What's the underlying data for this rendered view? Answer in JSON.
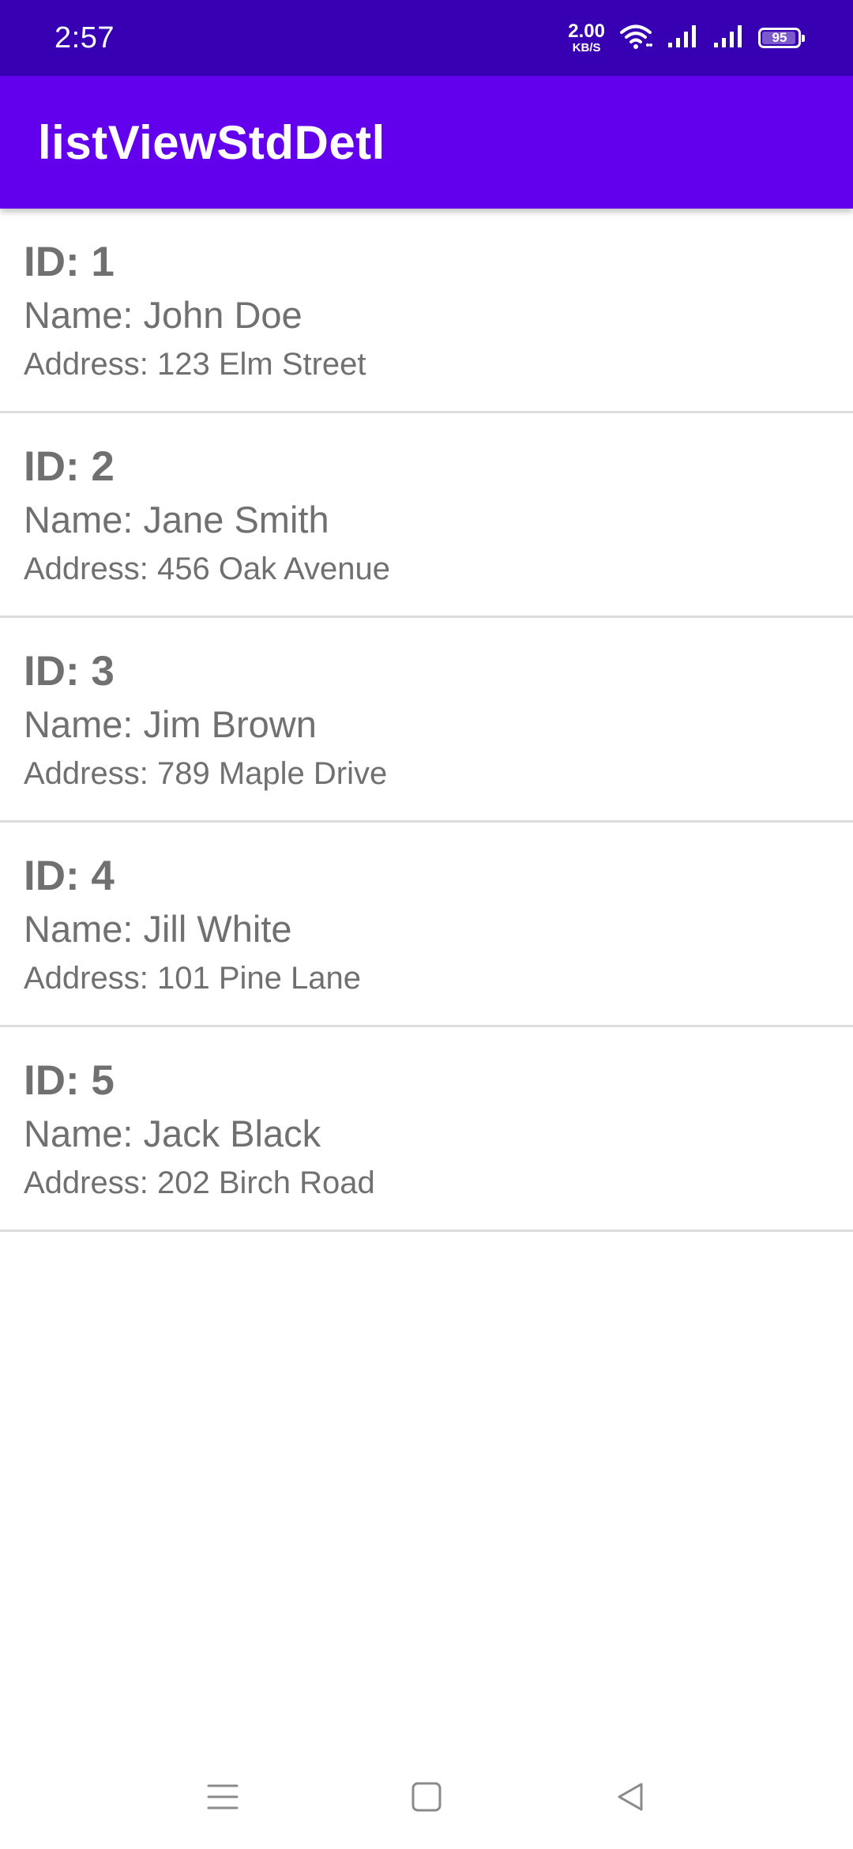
{
  "status_bar": {
    "time": "2:57",
    "net_speed_value": "2.00",
    "net_speed_unit": "KB/S",
    "battery_level": "95",
    "icons": [
      "wifi-icon",
      "signal-icon",
      "signal-icon",
      "battery-icon"
    ]
  },
  "app_bar": {
    "title": "listViewStdDetl",
    "color": "#6200ee",
    "status_color": "#3700b3"
  },
  "students": [
    {
      "id": "ID: 1",
      "name": "Name: John Doe",
      "address": "Address: 123 Elm Street"
    },
    {
      "id": "ID: 2",
      "name": "Name: Jane Smith",
      "address": "Address: 456 Oak Avenue"
    },
    {
      "id": "ID: 3",
      "name": "Name: Jim Brown",
      "address": "Address: 789 Maple Drive"
    },
    {
      "id": "ID: 4",
      "name": "Name: Jill White",
      "address": "Address: 101 Pine Lane"
    },
    {
      "id": "ID: 5",
      "name": "Name: Jack Black",
      "address": "Address: 202 Birch Road"
    }
  ],
  "nav_bar": {
    "buttons": [
      "menu-icon",
      "home-icon",
      "back-icon"
    ]
  }
}
